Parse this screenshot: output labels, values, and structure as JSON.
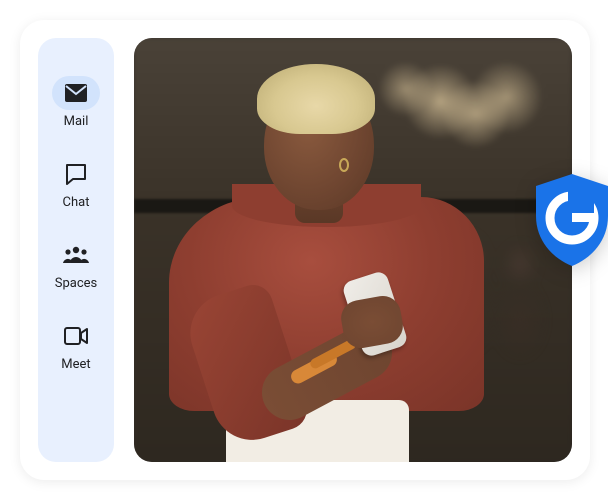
{
  "sidebar": {
    "items": [
      {
        "label": "Mail",
        "icon": "mail-icon",
        "active": true
      },
      {
        "label": "Chat",
        "icon": "chat-icon",
        "active": false
      },
      {
        "label": "Spaces",
        "icon": "spaces-icon",
        "active": false
      },
      {
        "label": "Meet",
        "icon": "meet-icon",
        "active": false
      }
    ]
  },
  "badge": {
    "name": "google-shield-icon",
    "letter": "G",
    "color": "#1a73e8"
  }
}
